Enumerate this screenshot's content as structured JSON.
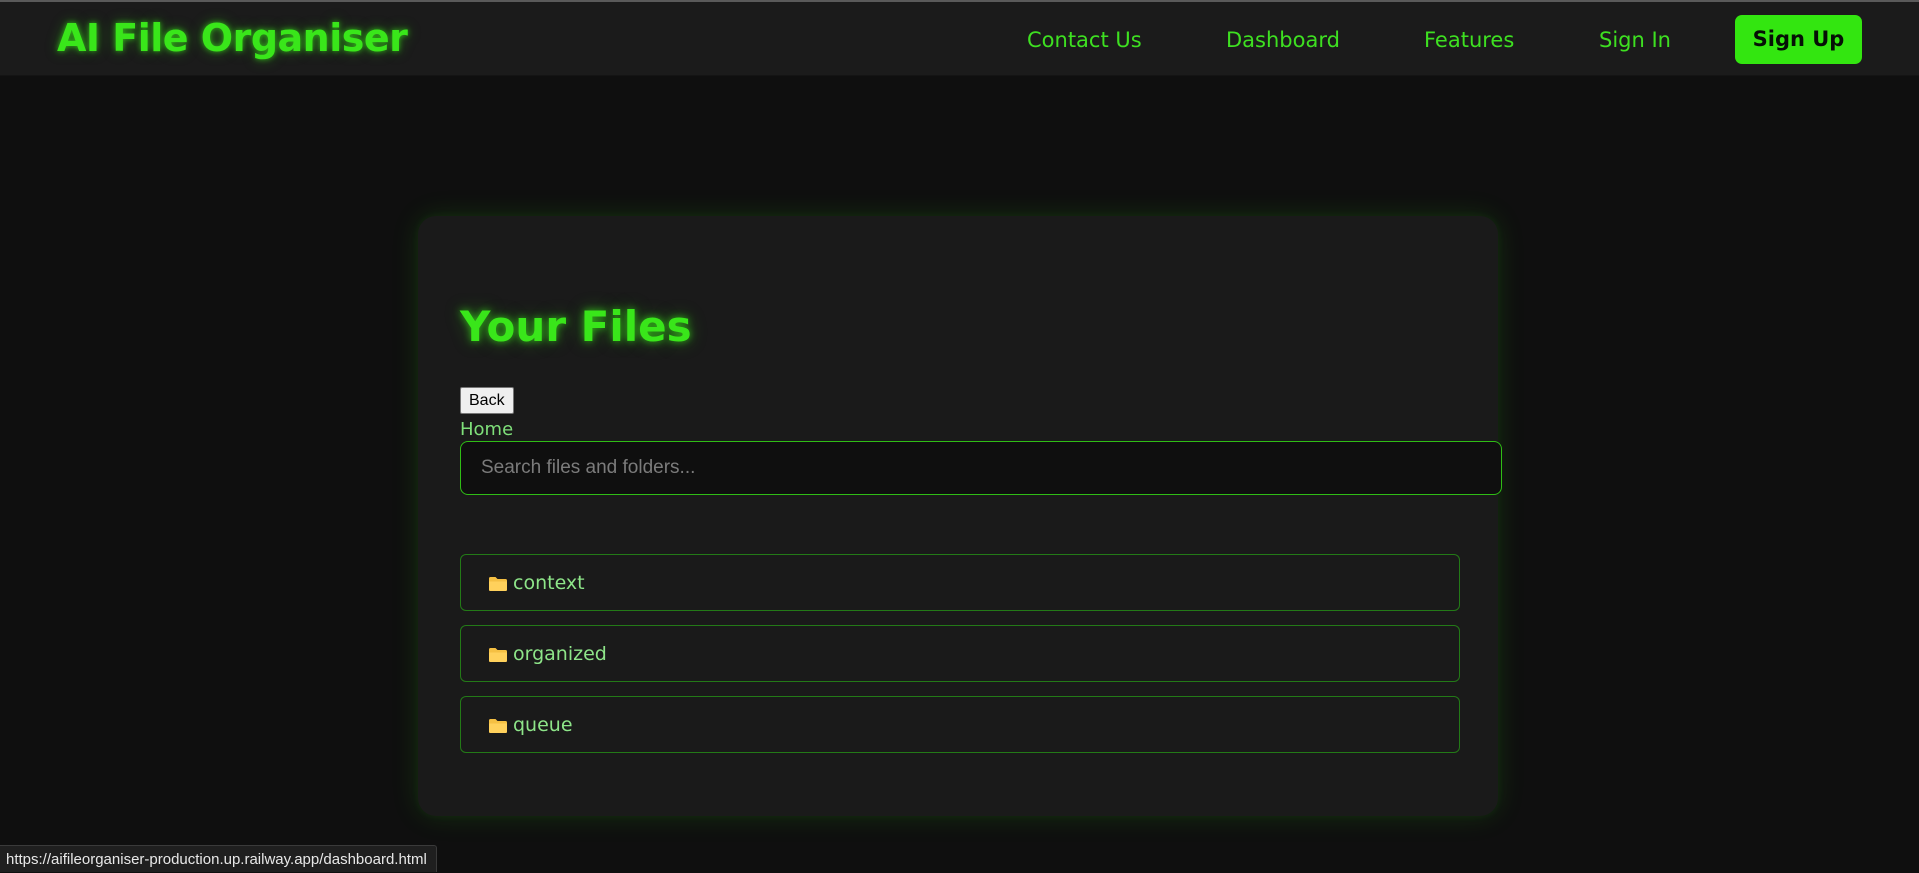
{
  "app": {
    "brand": "AI File Organiser"
  },
  "nav": {
    "links": [
      {
        "label": "Contact Us"
      },
      {
        "label": "Dashboard"
      },
      {
        "label": "Features"
      },
      {
        "label": "Sign In"
      }
    ],
    "signup_label": "Sign Up"
  },
  "main": {
    "title": "Your Files",
    "back_label": "Back",
    "breadcrumb": "Home",
    "search": {
      "placeholder": "Search files and folders...",
      "value": ""
    },
    "folders": [
      {
        "name": "context",
        "icon": "folder-icon"
      },
      {
        "name": "organized",
        "icon": "folder-icon"
      },
      {
        "name": "queue",
        "icon": "folder-icon"
      }
    ]
  },
  "status_bar": {
    "url": "https://aifileorganiser-production.up.railway.app/dashboard.html"
  },
  "colors": {
    "accent": "#39e61a",
    "background": "#0f0f0f",
    "panel": "#1a1a1a",
    "folder_icon": "#f5c043"
  }
}
